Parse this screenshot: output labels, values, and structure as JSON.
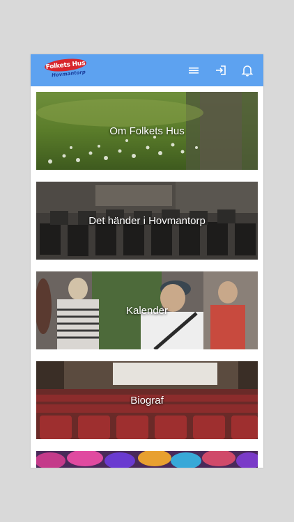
{
  "header": {
    "logo": {
      "title": "Folkets Hus",
      "subtitle": "Hovmantorp"
    },
    "icons": [
      "menu-icon",
      "login-icon",
      "bell-icon"
    ],
    "color": "#5da2f0"
  },
  "tiles": [
    {
      "label": "Om Folkets Hus"
    },
    {
      "label": "Det händer i Hovmantorp"
    },
    {
      "label": "Kalender"
    },
    {
      "label": "Biograf"
    }
  ],
  "colors": {
    "brand_red": "#d7262d",
    "brand_blue": "#1b3f9c",
    "background": "#d9d9d9"
  }
}
